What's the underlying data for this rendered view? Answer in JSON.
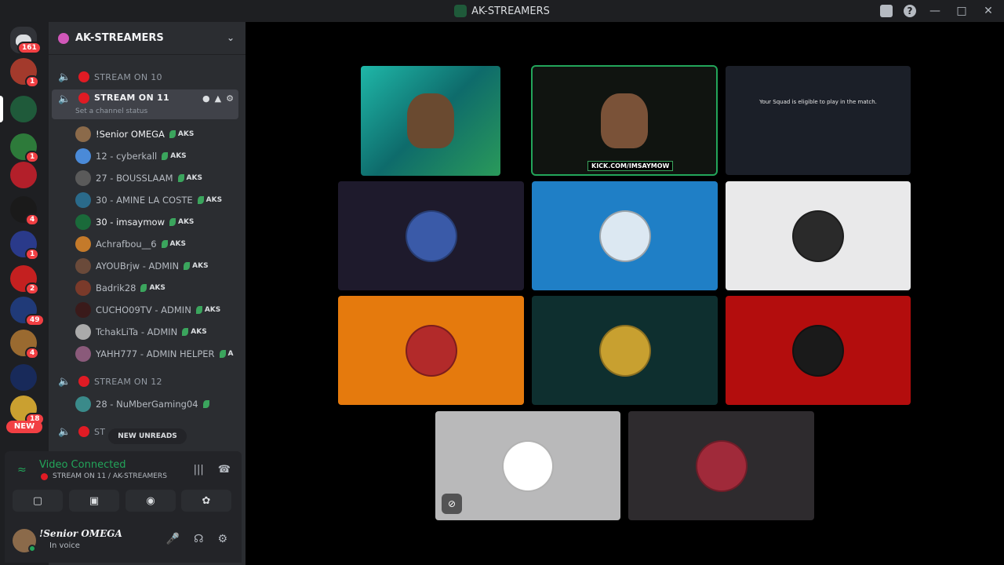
{
  "window": {
    "title": "AK-STREAMERS"
  },
  "guilds": {
    "home_badge": "161",
    "items": [
      {
        "badge": "1",
        "color": "#a33a2c"
      },
      {
        "badge": "",
        "color": "#1f5a3a"
      },
      {
        "badge": "1",
        "color": "#2d7a3a"
      },
      {
        "badge": "",
        "color": "#b31f2a"
      },
      {
        "badge": "4",
        "color": "#1a1a1a"
      },
      {
        "badge": "1",
        "color": "#2a3a8a"
      },
      {
        "badge": "2",
        "color": "#c42020"
      },
      {
        "badge": "49",
        "color": "#203a78"
      },
      {
        "badge": "4",
        "color": "#9a6a30"
      },
      {
        "badge": "",
        "color": "#182a5a"
      },
      {
        "badge": "18",
        "color": "#caa030"
      }
    ],
    "new_label": "NEW"
  },
  "sidebar": {
    "server_name": "AK-STREAMERS",
    "channels": {
      "stream10": "STREAM ON 10",
      "stream11": "STREAM ON 11",
      "stream11_status": "Set a channel status",
      "stream12": "STREAM ON 12",
      "next_prefix": "ST"
    },
    "users_11": [
      {
        "name": "!Senior OMEGA",
        "tag": "AKS",
        "av": "#8b6a4a"
      },
      {
        "name": "12 - cyberkall",
        "tag": "AKS",
        "av": "#4a8ad8"
      },
      {
        "name": "27 - BOUSSLAAM",
        "tag": "AKS",
        "av": "#5a5a5a"
      },
      {
        "name": "30 - AMINE LA COSTE",
        "tag": "AKS",
        "av": "#2a6a8a"
      },
      {
        "name": "30 - imsaymow",
        "tag": "AKS",
        "av": "#1a6a3a"
      },
      {
        "name": "Achrafbou__6",
        "tag": "AKS",
        "av": "#c47a2a"
      },
      {
        "name": "AYOUBrjw - ADMIN",
        "tag": "AKS",
        "av": "#6a4a3a"
      },
      {
        "name": "Badrik28",
        "tag": "AKS",
        "av": "#7a3a2a"
      },
      {
        "name": "CUCHO09TV - ADMIN",
        "tag": "AKS",
        "av": "#3a1a1a"
      },
      {
        "name": "TchakLiTa - ADMIN",
        "tag": "AKS",
        "av": "#aaaaaa"
      },
      {
        "name": "YAHH777 - ADMIN HELPER",
        "tag": "A",
        "av": "#8a5a7a"
      }
    ],
    "users_12": [
      {
        "name": "28 - NuMberGaming04",
        "tag": "",
        "av": "#3a8a8a"
      }
    ],
    "new_unreads": "NEW UNREADS"
  },
  "voice": {
    "title": "Video Connected",
    "subtitle": "STREAM ON 11 / AK-STREAMERS"
  },
  "user_panel": {
    "name": "!Senior OMEGA",
    "status": "In voice"
  },
  "stage": {
    "stream_label": "KICK.COM/IMSAYMOW",
    "game_text": "Your Squad is eligible to play in the match.",
    "tiles": [
      {
        "bg": "#1e1a2c",
        "av": "#3a5aa8"
      },
      {
        "bg": "#1f7fc6",
        "av": "#dce8f2"
      },
      {
        "bg": "#e9e9ea",
        "av": "#2a2a2a"
      },
      {
        "bg": "#e57a0d",
        "av": "#b22a2a"
      },
      {
        "bg": "#0e2f2f",
        "av": "#c8a030"
      },
      {
        "bg": "#b30d0d",
        "av": "#1a1a1a"
      },
      {
        "bg": "#b9b9ba",
        "av": "#ffffff"
      },
      {
        "bg": "#2e2b2e",
        "av": "#a02a3a"
      }
    ]
  }
}
